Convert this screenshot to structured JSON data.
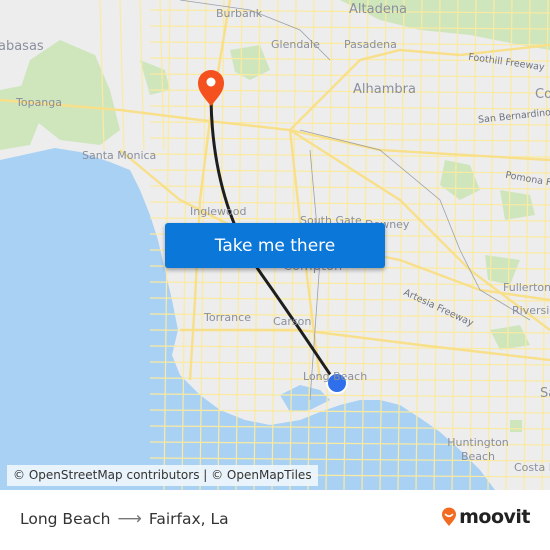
{
  "map": {
    "origin_label": "Long Beach",
    "destination_label": "Fairfax, La",
    "places": [
      {
        "id": "burbank",
        "label": "Burbank"
      },
      {
        "id": "altadena",
        "label": "Altadena"
      },
      {
        "id": "calabasas",
        "label": "abasas"
      },
      {
        "id": "glendale",
        "label": "Glendale"
      },
      {
        "id": "pasadena",
        "label": "Pasadena"
      },
      {
        "id": "foothill",
        "label": "Foothill Freeway"
      },
      {
        "id": "topanga",
        "label": "Topanga"
      },
      {
        "id": "alhambra",
        "label": "Alhambra"
      },
      {
        "id": "covina",
        "label": "Co"
      },
      {
        "id": "san-bernardino",
        "label": "San Bernardino"
      },
      {
        "id": "santa-monica",
        "label": "Santa Monica"
      },
      {
        "id": "pomona",
        "label": "Pomona Fr"
      },
      {
        "id": "inglewood",
        "label": "Inglewood"
      },
      {
        "id": "south-gate",
        "label": "South Gate"
      },
      {
        "id": "downey",
        "label": "Downey"
      },
      {
        "id": "compton",
        "label": "Compton"
      },
      {
        "id": "artesia",
        "label": "Artesia Freeway"
      },
      {
        "id": "fullerton",
        "label": "Fullerton"
      },
      {
        "id": "riverside",
        "label": "Riverside"
      },
      {
        "id": "torrance",
        "label": "Torrance"
      },
      {
        "id": "carson",
        "label": "Carson"
      },
      {
        "id": "long-beach",
        "label": "Long Beach"
      },
      {
        "id": "santa-ana",
        "label": "Sa"
      },
      {
        "id": "huntington",
        "label": "Huntington Beach"
      },
      {
        "id": "costa-mesa",
        "label": "Costa M"
      }
    ],
    "attribution": "© OpenStreetMap contributors | © OpenMapTiles",
    "cta_label": "Take me there",
    "colors": {
      "route_line": "#1e1e1e",
      "destination_pin": "#f4511e",
      "origin_dot": "#2f6fec",
      "cta_background": "#0b77d9",
      "water": "#a9d1f4",
      "park": "#c8e3b4"
    }
  },
  "footer": {
    "origin": "Long Beach",
    "arrow": "⟶",
    "destination": "Fairfax, La",
    "brand": "moovit",
    "brand_color": "#f26b21"
  }
}
